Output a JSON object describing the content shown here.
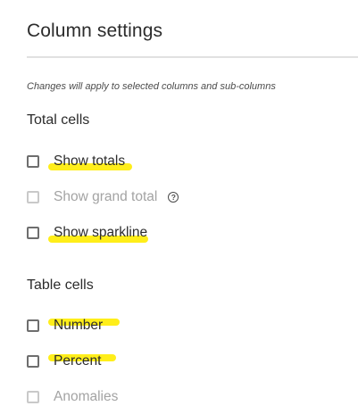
{
  "panel": {
    "title": "Column settings",
    "note": "Changes will apply to selected columns and sub-columns"
  },
  "total_cells": {
    "heading": "Total cells",
    "items": [
      {
        "label": "Show totals",
        "checked": false,
        "disabled": false,
        "highlighted": true
      },
      {
        "label": "Show grand total",
        "checked": false,
        "disabled": true,
        "highlighted": false,
        "help_icon": "question-circle-icon",
        "help_glyph": "?"
      },
      {
        "label": "Show sparkline",
        "checked": false,
        "disabled": false,
        "highlighted": true
      }
    ]
  },
  "table_cells": {
    "heading": "Table cells",
    "items": [
      {
        "label": "Number",
        "checked": false,
        "disabled": false,
        "highlighted": true
      },
      {
        "label": "Percent",
        "checked": false,
        "disabled": false,
        "highlighted": true
      },
      {
        "label": "Anomalies",
        "checked": false,
        "disabled": true,
        "highlighted": false
      }
    ]
  },
  "colors": {
    "highlight": "#ffee1a",
    "text": "#2c2c2c",
    "disabled_text": "#a3a3a3",
    "divider": "#e1e1e1"
  }
}
